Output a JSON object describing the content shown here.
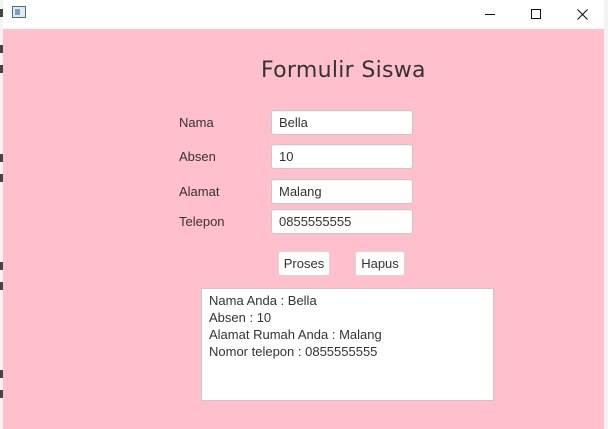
{
  "window": {
    "title": "",
    "controls": {
      "minimize_icon": "minimize-icon",
      "maximize_icon": "maximize-icon",
      "close_icon": "close-icon"
    }
  },
  "colors": {
    "background": "#ffc0cb",
    "text": "#333333",
    "field": "#ffffff"
  },
  "form": {
    "title": "Formulir Siswa",
    "fields": [
      {
        "label": "Nama",
        "value": "Bella"
      },
      {
        "label": "Absen",
        "value": "10"
      },
      {
        "label": "Alamat",
        "value": "Malang"
      },
      {
        "label": "Telepon",
        "value": "0855555555"
      }
    ],
    "buttons": {
      "proses": "Proses",
      "hapus": "Hapus"
    },
    "output": [
      "Nama Anda : Bella",
      "Absen : 10",
      "Alamat Rumah Anda : Malang",
      "Nomor telepon : 0855555555"
    ]
  }
}
